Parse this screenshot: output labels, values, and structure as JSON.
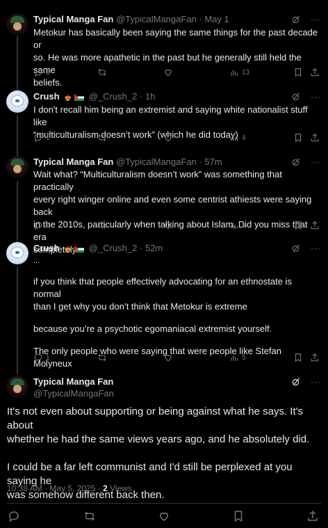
{
  "tweets": [
    {
      "name": "Typical Manga Fan",
      "handle": "@TypicalMangaFan",
      "time": "May 1",
      "lines": [
        "Metokur has basically been saying the same things for the past decade or",
        "so. He was more apathetic in the past but he generally still held the same",
        "beliefs."
      ],
      "replies": "1",
      "views": "13"
    },
    {
      "name": "Crush",
      "handle": "@_Crush_2",
      "time": "1h",
      "lines": [
        "I don't recall him being an extremist and saying white nationalist stuff like",
        "“multiculturalism doesn’t work” (which he did today)"
      ],
      "replies": "1",
      "views": "4"
    },
    {
      "name": "Typical Manga Fan",
      "handle": "@TypicalMangaFan",
      "time": "57m",
      "lines": [
        "Wait what? “Multiculturalism doesn’t work” was something that practically",
        "every right winger online and even some centrist athiests were saying back",
        "in the 2010s, particularly when talking about Islam. Did you miss that era",
        "completely?"
      ],
      "replies": "1",
      "views": "5"
    },
    {
      "name": "Crush",
      "handle": "@_Crush_2",
      "time": "52m",
      "lines": [
        "...",
        "if you think that people effectively advocating for an ethnostate is normal",
        "than I get why you don’t think that Metokur is extreme",
        "because you’re a psychotic egomaniacal extremist yourself.",
        "The only people who were saying that were people like Stefan Molyneux"
      ],
      "replies": "1",
      "views": "5"
    }
  ],
  "focus": {
    "name": "Typical Manga Fan",
    "handle": "@TypicalMangaFan",
    "para1": [
      "It's not even about supporting or being against what he says. It's about",
      "whether he had the same views years ago, and he absolutely did."
    ],
    "para2": [
      "I could be a far left communist and I'd still be perplexed at you saying he",
      "was somehow different back then."
    ],
    "timestamp": "10:38 AM · May 5, 2025 · ",
    "views_count": "2",
    "views_label": " Views"
  },
  "separator": " · ",
  "more": "···",
  "colors": {
    "background": "#000000",
    "text": "#e7e9ea",
    "muted": "#71767b",
    "line": "#333639"
  },
  "icons": [
    "reply-icon",
    "retweet-icon",
    "like-icon",
    "views-icon",
    "bookmark-icon",
    "share-icon",
    "grok-icon",
    "more-icon"
  ]
}
